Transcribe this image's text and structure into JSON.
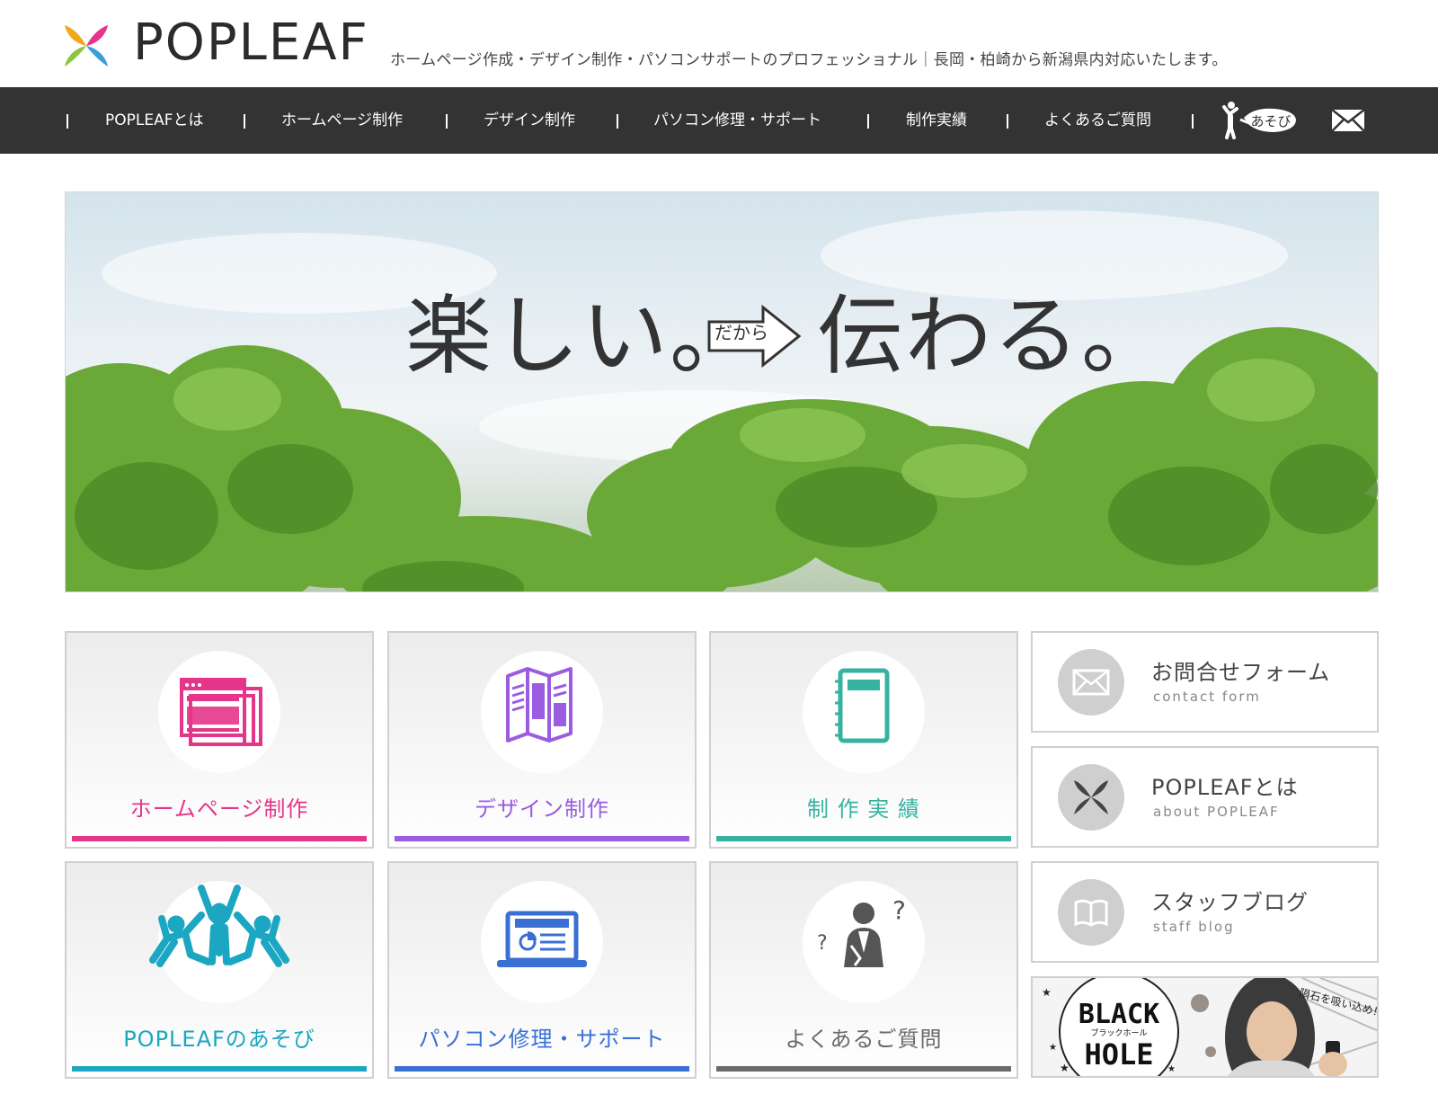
{
  "header": {
    "logo_text": "POPLEAF",
    "tagline": "ホームページ作成・デザイン制作・パソコンサポートのプロフェッショナル｜長岡・柏崎から新潟県内対応いたします。"
  },
  "nav": {
    "items": [
      "POPLEAFとは",
      "ホームページ制作",
      "デザイン制作",
      "パソコン修理・サポート",
      "制作実績",
      "よくあるご質問"
    ],
    "asobi_label": "あそび",
    "mail_icon": "envelope-icon"
  },
  "hero": {
    "left_text": "楽しい。",
    "arrow_label": "だから",
    "right_text": "伝わる。"
  },
  "tiles": [
    {
      "label": "ホームページ制作",
      "color": "#e5358a",
      "icon": "webpage-icon"
    },
    {
      "label": "デザイン制作",
      "color": "#9b5ce0",
      "icon": "brochure-icon"
    },
    {
      "label": "制 作 実 績",
      "color": "#36b3a0",
      "icon": "notebook-icon"
    },
    {
      "label": "POPLEAFのあそび",
      "color": "#1ba6c2",
      "icon": "dancing-people-icon"
    },
    {
      "label": "パソコン修理・サポート",
      "color": "#3a6fd4",
      "icon": "laptop-icon"
    },
    {
      "label": "よくあるご質問",
      "color": "#6a6a6a",
      "icon": "question-person-icon"
    }
  ],
  "side_links": [
    {
      "title": "お問合せフォーム",
      "subtitle": "contact form",
      "icon": "envelope-icon"
    },
    {
      "title": "POPLEAFとは",
      "subtitle": "about POPLEAF",
      "icon": "popleaf-logo-icon"
    },
    {
      "title": "スタッフブログ",
      "subtitle": "staff blog",
      "icon": "book-icon"
    }
  ],
  "banner": {
    "line1": "BLACK",
    "small": "ブラックホール",
    "line2": "HOLE",
    "caption": "隕石を吸い込め！"
  }
}
